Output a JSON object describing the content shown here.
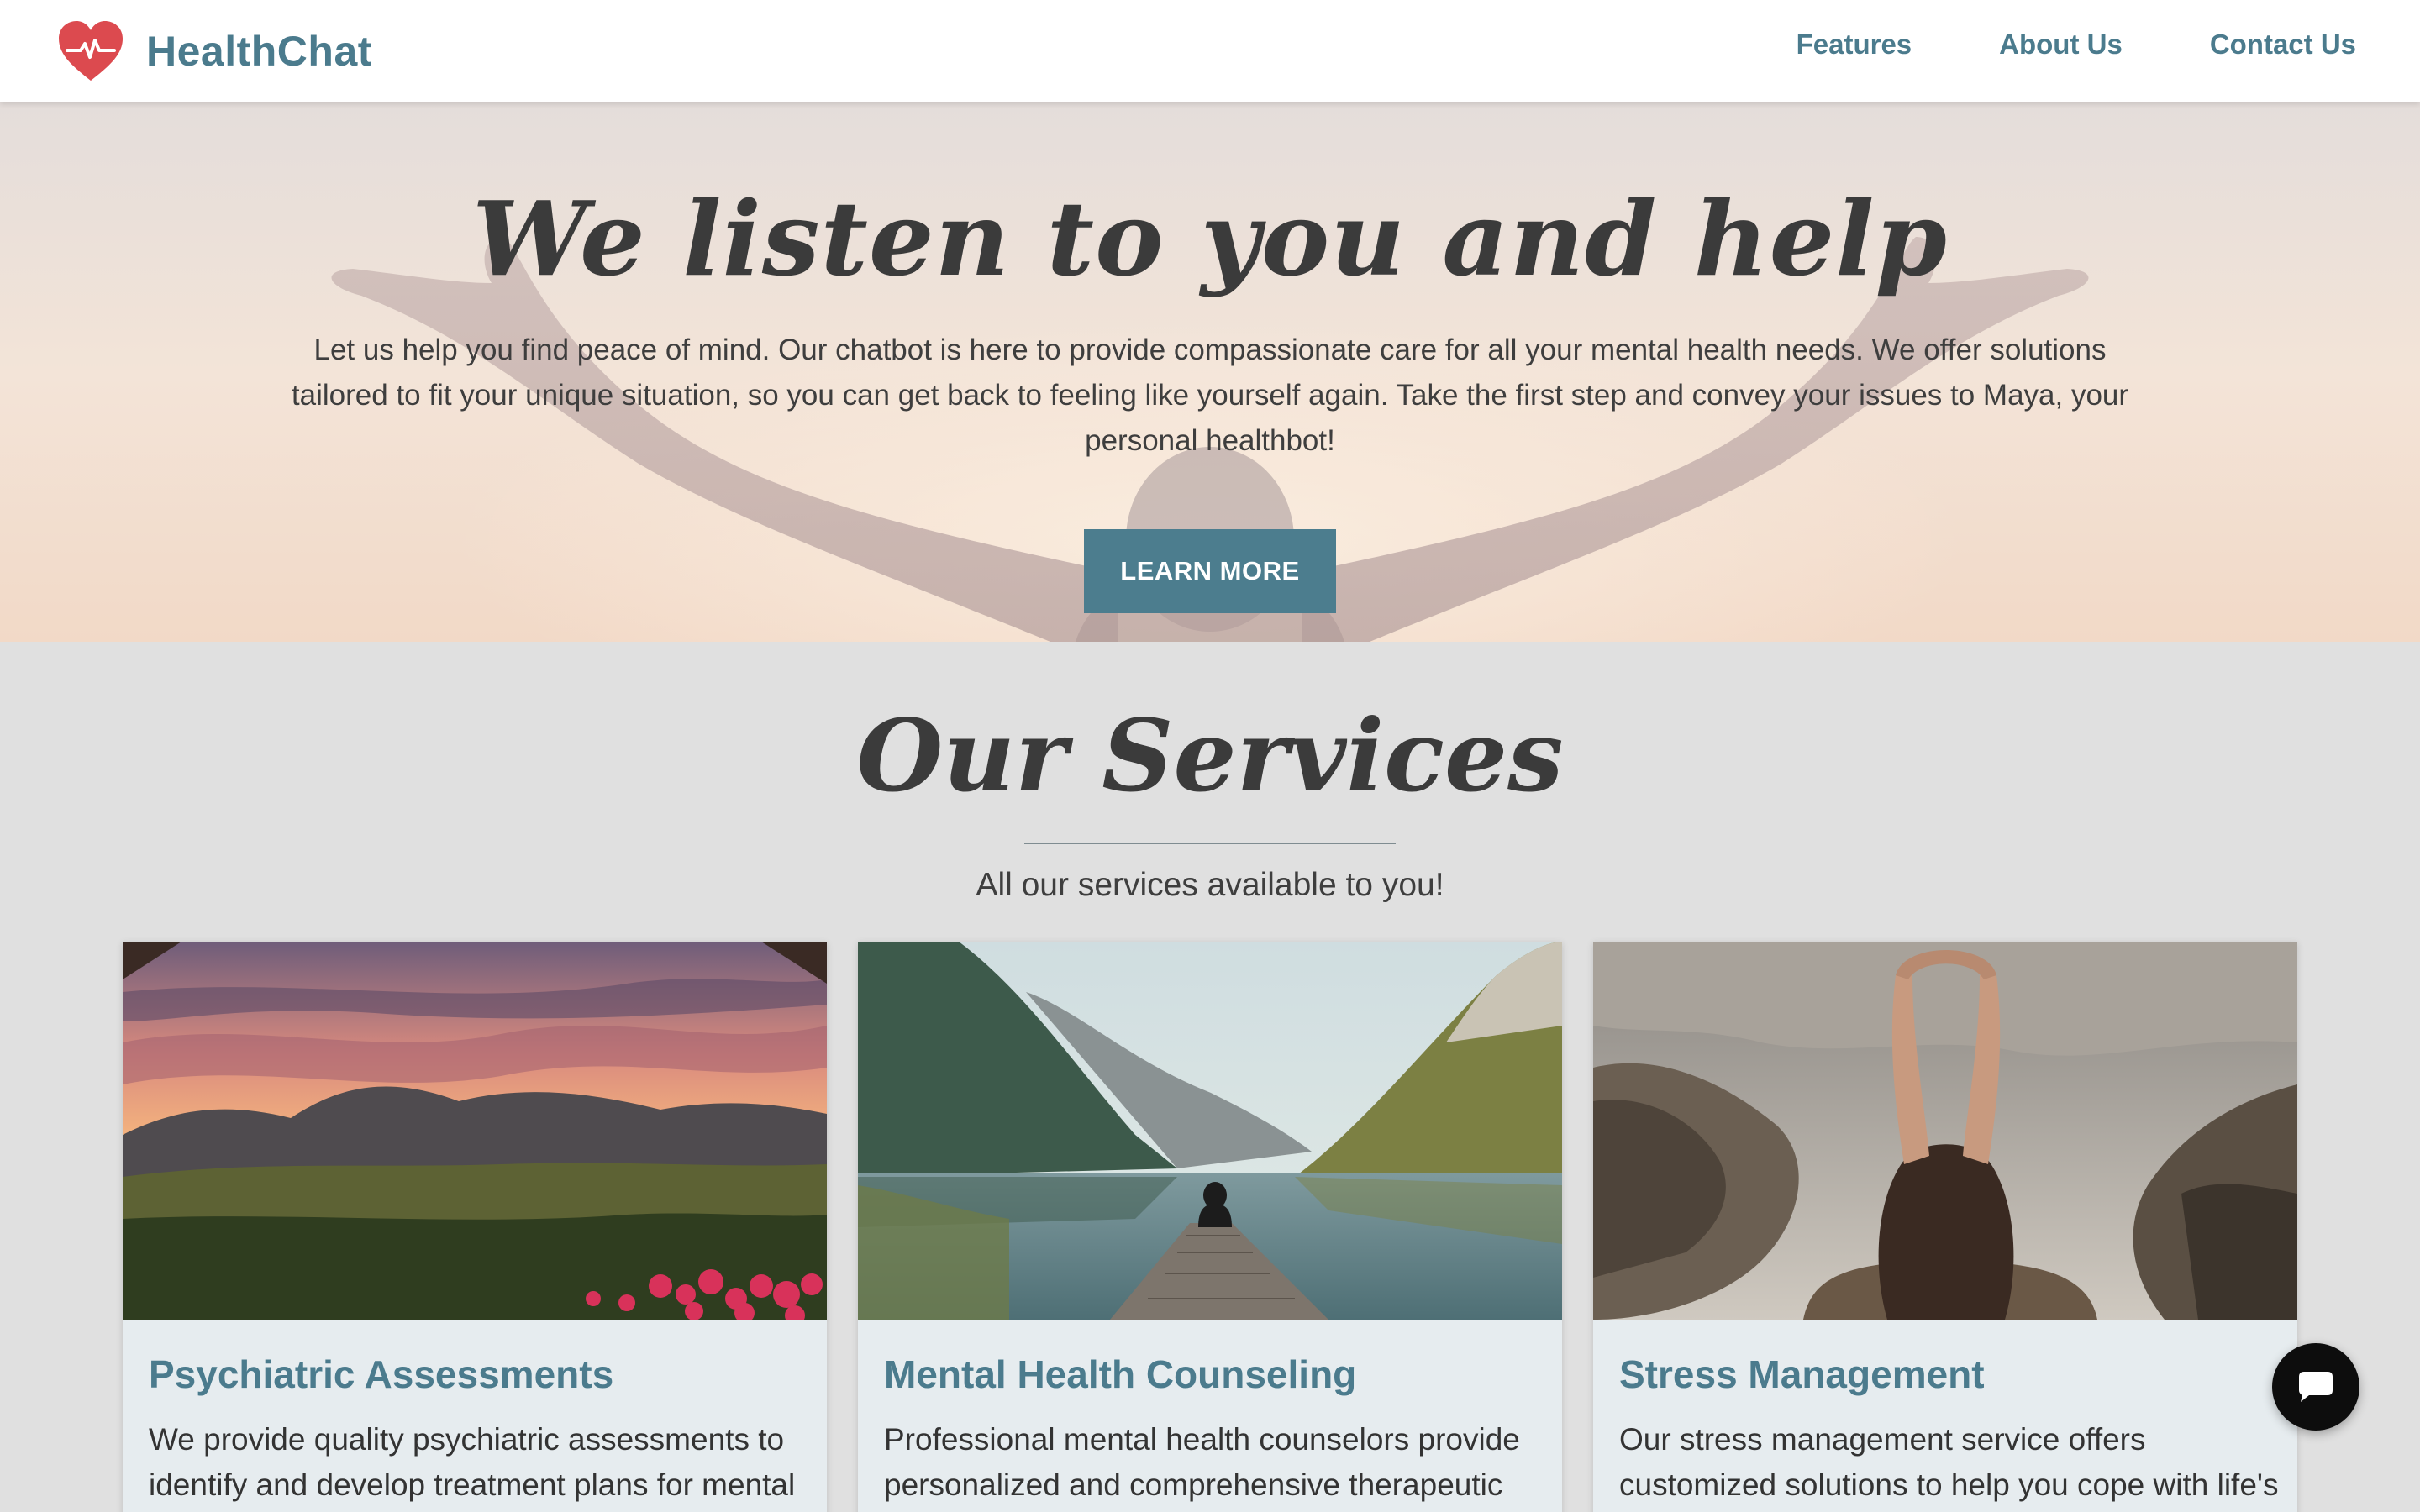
{
  "brand": {
    "name": "HealthChat",
    "icon": "heart-pulse-icon",
    "color": "#4b7b8d",
    "icon_color": "#dc4a4f"
  },
  "nav": {
    "items": [
      {
        "label": "Features"
      },
      {
        "label": "About Us"
      },
      {
        "label": "Contact Us"
      }
    ]
  },
  "hero": {
    "title": "We listen to you and help",
    "text": "Let us help you find peace of mind. Our chatbot is here to provide compassionate care for all your mental health needs. We offer solutions tailored to fit your unique situation, so you can get back to feeling like yourself again. Take the first step and convey your issues to Maya, your personal healthbot!",
    "button_label": "LEARN MORE",
    "button_color": "#4c7d8e"
  },
  "services": {
    "title": "Our Services",
    "subtitle": "All our services available to you!",
    "cards": [
      {
        "title": "Psychiatric Assessments",
        "description": "We provide quality psychiatric assessments to identify and develop treatment plans for mental",
        "image": "sunset-valley-image"
      },
      {
        "title": "Mental Health Counseling",
        "description": "Professional mental health counselors provide personalized and comprehensive therapeutic",
        "image": "lake-dock-image"
      },
      {
        "title": "Stress Management",
        "description": "Our stress management service offers customized solutions to help you cope with life's",
        "image": "woman-rocks-image"
      }
    ]
  },
  "chat": {
    "icon": "chat-bubble-icon"
  }
}
